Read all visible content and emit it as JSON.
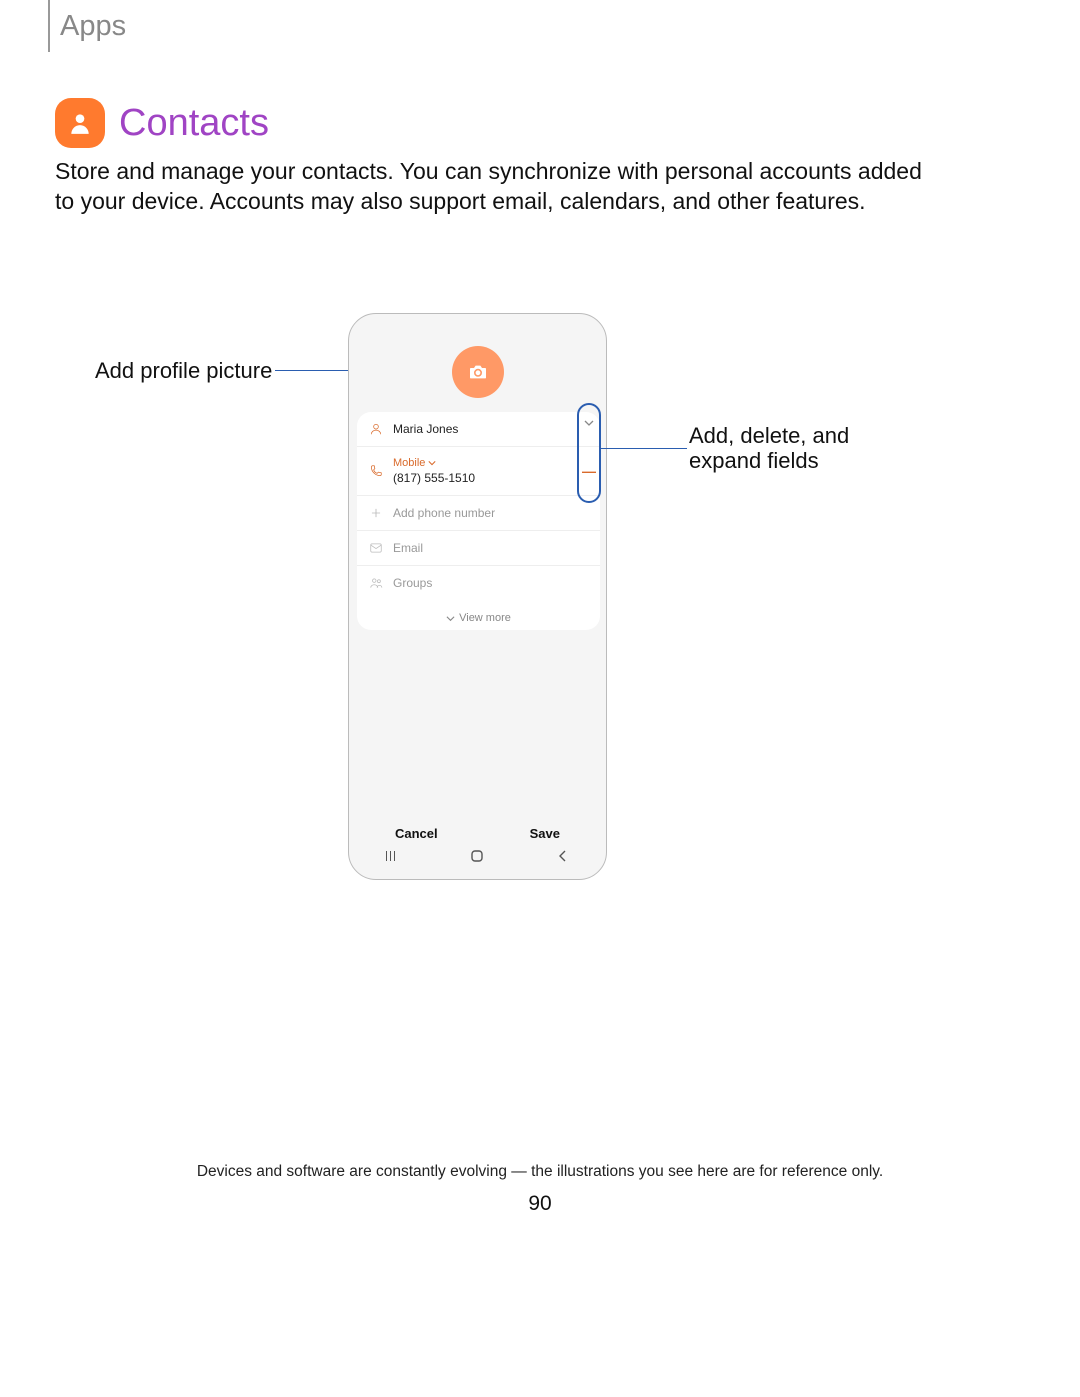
{
  "header": "Apps",
  "title": "Contacts",
  "intro": "Store and manage your contacts. You can synchronize with personal accounts added to your device. Accounts may also support email, calendars, and other features.",
  "callouts": {
    "left": "Add profile picture",
    "right_l1": "Add, delete, and",
    "right_l2": "expand fields"
  },
  "phone": {
    "name_value": "Maria Jones",
    "phone_type": "Mobile",
    "phone_number": "(817) 555-1510",
    "add_phone": "Add phone number",
    "email": "Email",
    "groups": "Groups",
    "view_more": "View more",
    "cancel": "Cancel",
    "save": "Save"
  },
  "footer": "Devices and software are constantly evolving — the illustrations you see here are for reference only.",
  "page_number": "90"
}
